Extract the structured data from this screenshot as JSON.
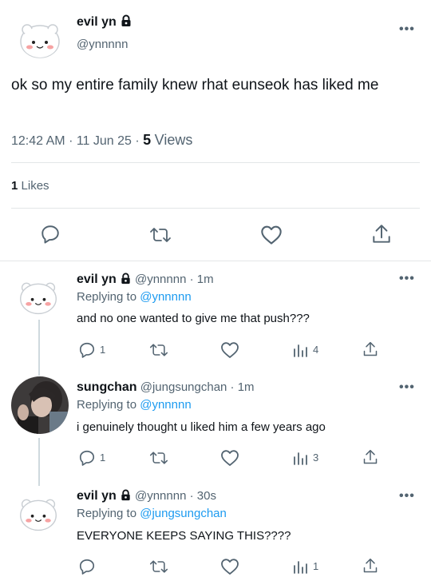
{
  "main_tweet": {
    "author_name": "evil yn",
    "handle": "@ynnnnn",
    "text": "ok so my entire family knew rhat eunseok has liked me",
    "time": "12:42 AM",
    "date": "11 Jun 25",
    "views_count": "5",
    "views_label": "Views",
    "likes_count": "1",
    "likes_label": "Likes"
  },
  "replies": [
    {
      "author_name": "evil yn",
      "handle": "@ynnnnn",
      "time_ago": "1m",
      "replying_prefix": "Replying to",
      "replying_to": "@ynnnnn",
      "text": "and no one wanted to give me that push???",
      "reply_count": "1",
      "views": "4"
    },
    {
      "author_name": "sungchan",
      "handle": "@jungsungchan",
      "time_ago": "1m",
      "replying_prefix": "Replying to",
      "replying_to": "@ynnnnn",
      "text": "i genuinely thought u liked him a few years ago",
      "reply_count": "1",
      "views": "3"
    },
    {
      "author_name": "evil yn",
      "handle": "@ynnnnn",
      "time_ago": "30s",
      "replying_prefix": "Replying to",
      "replying_to": "@jungsungchan",
      "text": "EVERYONE KEEPS SAYING THIS????",
      "reply_count": "",
      "views": "1"
    }
  ],
  "separators": {
    "dot": "·"
  },
  "icons": [
    "lock-icon",
    "more-icon",
    "reply-icon",
    "retweet-icon",
    "like-icon",
    "views-icon",
    "share-icon"
  ],
  "colors": {
    "accent": "#1d9bf0",
    "text": "#0f1419",
    "muted": "#536471",
    "divider": "#e3e6e8"
  }
}
